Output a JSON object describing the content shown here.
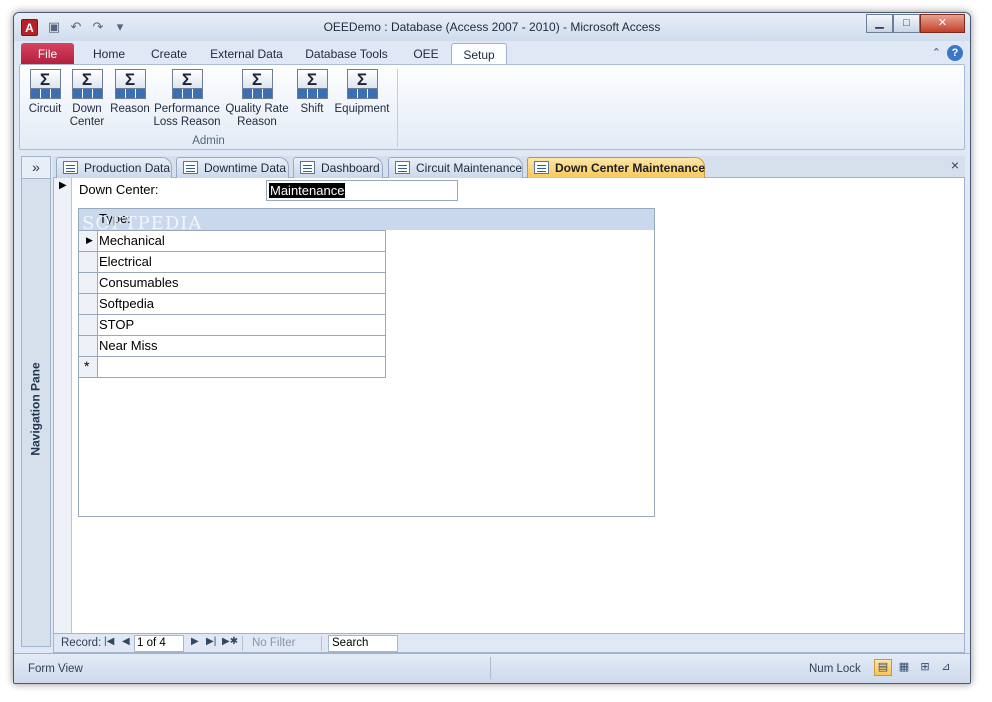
{
  "window": {
    "title": "OEEDemo : Database (Access 2007 - 2010)  -  Microsoft Access",
    "app_icon": "A",
    "controls": {
      "minimize": "▁",
      "maximize": "□",
      "close": "✕"
    }
  },
  "ribbon_tabs": [
    {
      "label": "File"
    },
    {
      "label": "Home"
    },
    {
      "label": "Create"
    },
    {
      "label": "External Data"
    },
    {
      "label": "Database Tools"
    },
    {
      "label": "OEE"
    },
    {
      "label": "Setup"
    }
  ],
  "active_ribbon_tab": "Setup",
  "ribbon": {
    "group_label": "Admin",
    "buttons": [
      {
        "line1": "Circuit",
        "line2": ""
      },
      {
        "line1": "Down",
        "line2": "Center"
      },
      {
        "line1": "Reason",
        "line2": ""
      },
      {
        "line1": "Performance",
        "line2": "Loss Reason"
      },
      {
        "line1": "Quality Rate",
        "line2": "Reason"
      },
      {
        "line1": "Shift",
        "line2": ""
      },
      {
        "line1": "Equipment",
        "line2": ""
      }
    ],
    "button_glyph": "Σ"
  },
  "nav_pane": {
    "toggle": "»",
    "title": "Navigation Pane"
  },
  "doc_tabs": [
    {
      "label": "Production Data"
    },
    {
      "label": "Downtime Data"
    },
    {
      "label": "Dashboard"
    },
    {
      "label": "Circuit Maintenance"
    },
    {
      "label": "Down Center Maintenance"
    }
  ],
  "active_doc_tab": "Down Center Maintenance",
  "doc_close": "×",
  "form": {
    "down_center_label": "Down Center:",
    "down_center_value": "Maintenance",
    "subform": {
      "header": "Type:",
      "rows": [
        "Mechanical",
        "Electrical",
        "Consumables",
        "Softpedia",
        "STOP",
        "Near Miss"
      ],
      "new_row_marker": "*"
    },
    "watermark": "SOFTPEDIA"
  },
  "record_nav": {
    "label": "Record:",
    "current": "1 of 4",
    "no_filter": "No Filter",
    "search": "Search",
    "first": "|◀",
    "prev": "◀",
    "next": "▶",
    "last": "▶|",
    "new": "▶✱"
  },
  "status_bar": {
    "left": "Form View",
    "num_lock": "Num Lock"
  },
  "colors": {
    "file_tab": "#c4294a",
    "active_doc_tab": "#f7c85a",
    "subform_header": "#c9d8ed"
  }
}
